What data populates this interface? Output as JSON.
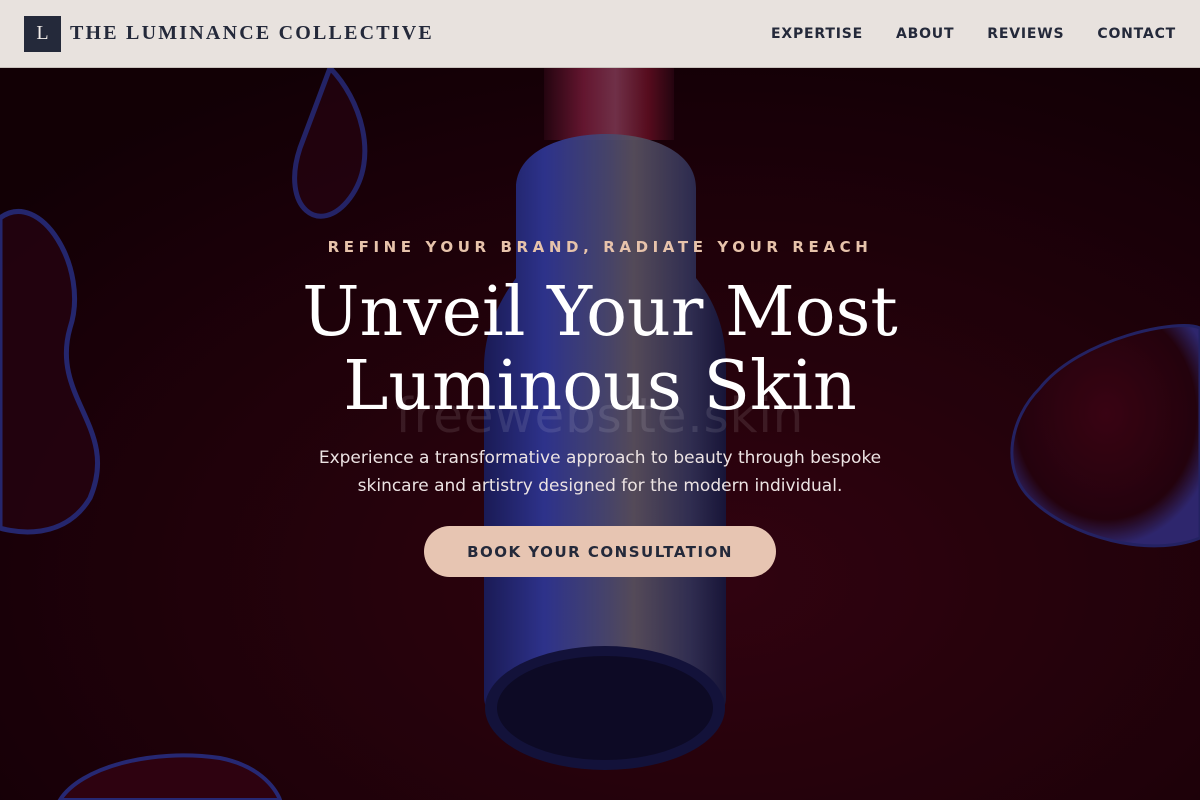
{
  "header": {
    "logo_letter": "L",
    "brand_name": "THE LUMINANCE COLLECTIVE",
    "nav": [
      "EXPERTISE",
      "ABOUT",
      "REVIEWS",
      "CONTACT"
    ]
  },
  "hero": {
    "eyebrow": "REFINE YOUR BRAND, RADIATE YOUR REACH",
    "headline_line1": "Unveil Your Most",
    "headline_line2": "Luminous Skin",
    "watermark": "freewebsite.skin",
    "subtitle_line1": "Experience a transformative approach to beauty through bespoke",
    "subtitle_line2": "skincare and artistry designed for the modern individual.",
    "cta_label": "BOOK YOUR CONSULTATION"
  },
  "colors": {
    "header_bg": "#e8e2de",
    "navy": "#24293a",
    "accent_peach": "#e7c5b2",
    "eyebrow": "#e7c3ab",
    "hero_bg": "#1a0008"
  }
}
